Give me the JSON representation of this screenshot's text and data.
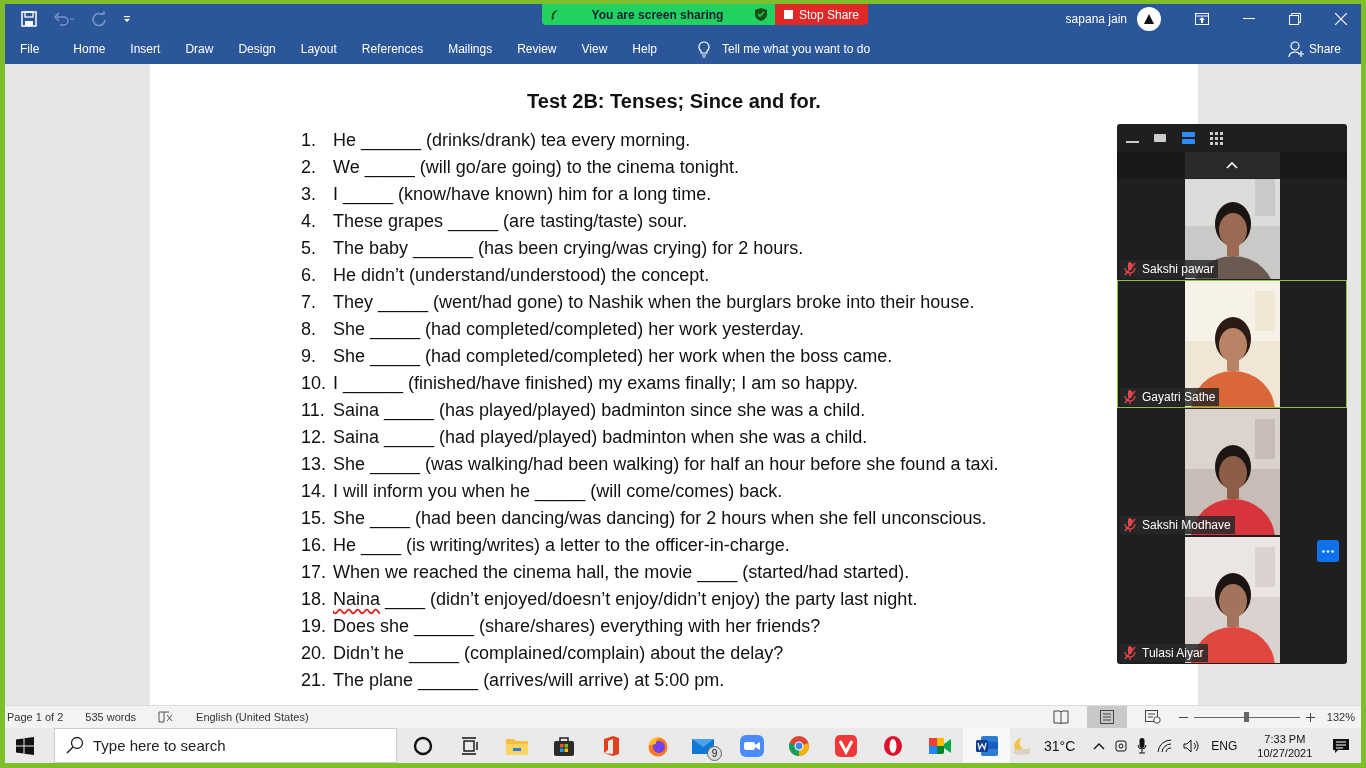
{
  "sharing_bar": {
    "status": "You are screen sharing",
    "stop_button": "Stop Share"
  },
  "title_bar": {
    "user_name": "sapana jain"
  },
  "ribbon": {
    "file_tab": "File",
    "tabs": [
      {
        "label": "Home"
      },
      {
        "label": "Insert"
      },
      {
        "label": "Draw"
      },
      {
        "label": "Design"
      },
      {
        "label": "Layout"
      },
      {
        "label": "References"
      },
      {
        "label": "Mailings"
      },
      {
        "label": "Review"
      },
      {
        "label": "View"
      },
      {
        "label": "Help"
      }
    ],
    "tell_me": {
      "placeholder": "Tell me what you want to do"
    },
    "share_button": "Share"
  },
  "document": {
    "title": "Test 2B: Tenses; Since and for.",
    "items": [
      {
        "number": "1.",
        "text": "He ______ (drinks/drank) tea every morning."
      },
      {
        "number": "2.",
        "text": "We _____ (will go/are going) to the cinema tonight."
      },
      {
        "number": "3.",
        "text": "I _____ (know/have known) him for a long time."
      },
      {
        "number": "4.",
        "text": "These grapes _____ (are tasting/taste) sour."
      },
      {
        "number": "5.",
        "text": "The baby ______ (has been crying/was crying) for 2 hours."
      },
      {
        "number": "6.",
        "text": "He didn’t (understand/understood) the concept."
      },
      {
        "number": "7.",
        "text": "They _____ (went/had gone) to Nashik when the burglars broke into their house."
      },
      {
        "number": "8.",
        "text": "She _____ (had completed/completed) her work yesterday."
      },
      {
        "number": "9.",
        "text": "She _____ (had completed/completed) her work when the boss came."
      },
      {
        "number": "10.",
        "text": "I ______ (finished/have finished) my exams finally; I am so happy."
      },
      {
        "number": "11.",
        "text": "Saina _____ (has played/played) badminton since she was a child."
      },
      {
        "number": "12.",
        "text": "Saina _____ (had played/played) badminton when she was a child."
      },
      {
        "number": "13.",
        "text": "She _____ (was walking/had been walking) for half an hour before she found a taxi."
      },
      {
        "number": "14.",
        "text": "I will inform you when he _____ (will come/comes) back."
      },
      {
        "number": "15.",
        "text": "She ____ (had been dancing/was dancing) for 2 hours when she fell unconscious."
      },
      {
        "number": "16.",
        "text": "He ____ (is writing/writes) a letter to the officer-in-charge."
      },
      {
        "number": "17.",
        "text": "When we reached the cinema hall, the movie ____ (started/had started)."
      },
      {
        "number": "18.",
        "parts": [
          {
            "text": "Naina",
            "misspelled": true
          },
          {
            "text": " ____ (didn’t enjoyed/doesn’t enjoy/didn’t enjoy) the party last night.",
            "misspelled": false
          }
        ]
      },
      {
        "number": "19.",
        "text": "Does she ______ (share/shares) everything with her friends?"
      },
      {
        "number": "20.",
        "text": "Didn’t he _____ (complained/complain) about the delay?"
      },
      {
        "number": "21.",
        "text": "The plane ______ (arrives/will arrive) at 5:00 pm."
      }
    ]
  },
  "meeting_panel": {
    "view_modes": [
      {
        "kind": "minimize",
        "selected": false
      },
      {
        "kind": "thumbnail",
        "selected": false
      },
      {
        "kind": "speaker",
        "selected": true
      },
      {
        "kind": "gallery",
        "selected": false
      }
    ],
    "participants": [
      {
        "name": "Sakshi pawar",
        "muted": true,
        "speaking": false,
        "more_button": false
      },
      {
        "name": "Gayatri Sathe",
        "muted": true,
        "speaking": true,
        "more_button": false
      },
      {
        "name": "Sakshi Modhave",
        "muted": true,
        "speaking": false,
        "more_button": false
      },
      {
        "name": "Tulasi Aiyar",
        "muted": true,
        "speaking": false,
        "more_button": true
      }
    ]
  },
  "status_bar": {
    "page": "Page 1 of 2",
    "words": "535 words",
    "language": "English (United States)",
    "views": [
      {
        "kind": "read",
        "selected": false
      },
      {
        "kind": "print",
        "selected": true
      },
      {
        "kind": "web",
        "selected": false
      }
    ],
    "zoom": {
      "level": 0.49,
      "reading": "132%"
    }
  },
  "taskbar": {
    "search": {
      "placeholder": "Type here to search"
    },
    "apps": [
      {
        "kind": "cortana",
        "active": false
      },
      {
        "kind": "taskview",
        "active": false
      },
      {
        "kind": "explorer",
        "active": false
      },
      {
        "kind": "store",
        "active": false
      },
      {
        "kind": "office",
        "active": false
      },
      {
        "kind": "firefox",
        "active": false
      },
      {
        "kind": "mail",
        "active": false,
        "badge": "9"
      },
      {
        "kind": "zoom",
        "active": false
      },
      {
        "kind": "chrome",
        "active": false
      },
      {
        "kind": "vivaldi",
        "active": false
      },
      {
        "kind": "opera",
        "active": false
      },
      {
        "kind": "meet",
        "active": false
      },
      {
        "kind": "word",
        "active": true
      }
    ],
    "temperature": "31°C",
    "language": "ENG",
    "time": "7:33 PM",
    "date": "10/27/2021"
  }
}
